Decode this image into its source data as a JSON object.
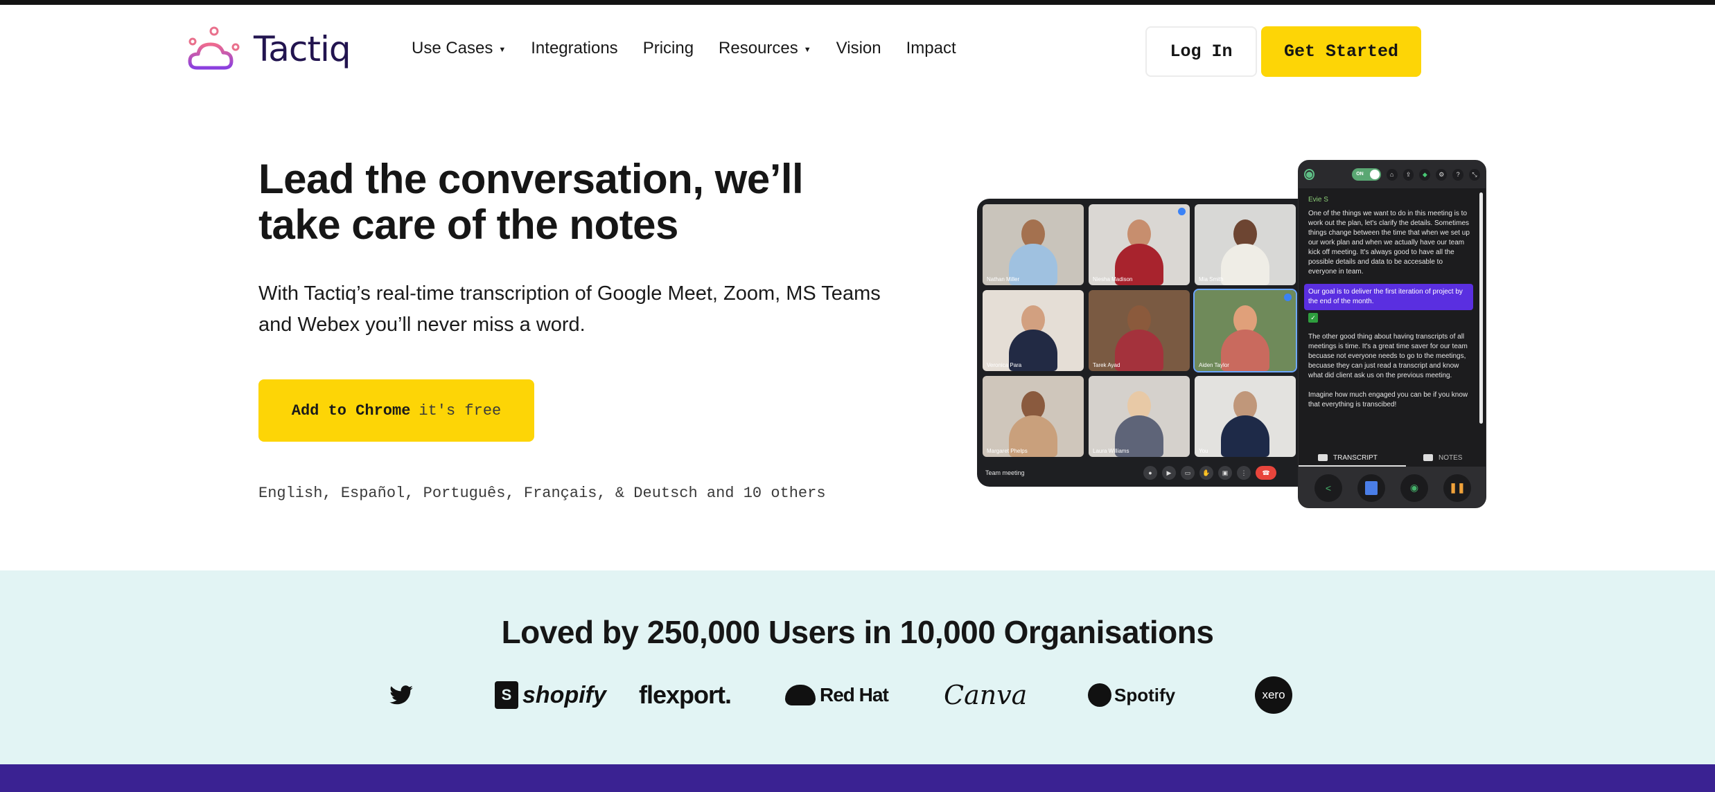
{
  "brand": {
    "name": "Tactiq",
    "primary_color": "#22144f",
    "accent_yellow": "#fdd506",
    "footer_purple": "#3a2292",
    "proof_bg": "#e2f4f4"
  },
  "nav": {
    "items": [
      {
        "label": "Use Cases",
        "dropdown": true
      },
      {
        "label": "Integrations",
        "dropdown": false
      },
      {
        "label": "Pricing",
        "dropdown": false
      },
      {
        "label": "Resources",
        "dropdown": true
      },
      {
        "label": "Vision",
        "dropdown": false
      },
      {
        "label": "Impact",
        "dropdown": false
      }
    ],
    "login_label": "Log In",
    "get_started_label": "Get Started"
  },
  "hero": {
    "title": "Lead the conversation, we’ll take care of the notes",
    "subtitle": "With Tactiq’s real-time transcription of Google Meet, Zoom, MS Teams and Webex you’ll never miss a word.",
    "cta_strong": "Add to Chrome",
    "cta_light": "it's free",
    "languages": "English, Español, Português, Français, & Deutsch and 10 others"
  },
  "meeting": {
    "title": "Team meeting",
    "participants": [
      {
        "name": "Nathan Miller"
      },
      {
        "name": "Niesha Madison"
      },
      {
        "name": "Mia Smith"
      },
      {
        "name": "Veronica Para"
      },
      {
        "name": "Tarek Ayad"
      },
      {
        "name": "Aiden Taylor"
      },
      {
        "name": "Margaret Phelps"
      },
      {
        "name": "Laura Williams"
      },
      {
        "name": "You"
      }
    ],
    "controls": [
      "mic-icon",
      "camera-icon",
      "captions-icon",
      "raise-hand-icon",
      "present-icon",
      "more-icon",
      "end-call-icon"
    ]
  },
  "panel": {
    "toggle_label": "ON",
    "speaker": "Evie S",
    "paragraph1": "One of the things we want to do in this meeting is to work out the plan, let's clarify the details. Sometimes things change between the time that when we set up our work plan and when we actually have our team kick off meeting. It's always good to have all the possible details and data to be accesable to everyone in team.",
    "highlight": "Our goal is to deliver the first iteration of project by the end of the month.",
    "paragraph2": "The other good thing about having transcripts of all meetings is time. It's a great time saver for our team becuase not everyone needs to go to the meetings, becuase they can just read a transcript and know what did client ask us on the previous meeting.",
    "paragraph3": "Imagine how much engaged you can be if you know that everything is transcibed!",
    "tab_transcript": "TRANSCRIPT",
    "tab_notes": "NOTES"
  },
  "proof": {
    "title": "Loved by 250,000 Users in 10,000 Organisations",
    "logos": [
      "Twitter",
      "shopify",
      "flexport.",
      "Red Hat",
      "Canva",
      "Spotify",
      "xero"
    ]
  }
}
